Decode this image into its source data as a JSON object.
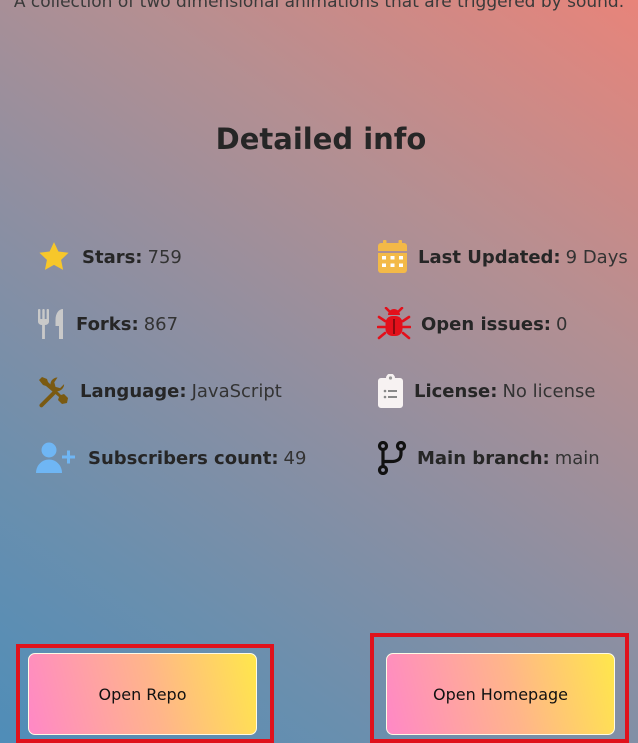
{
  "description": "A collection of two dimensional animations that are triggered by sound.",
  "section_title": "Detailed info",
  "stats": {
    "stars": {
      "label": "Stars:",
      "value": "759",
      "icon": "star-icon"
    },
    "forks": {
      "label": "Forks:",
      "value": "867",
      "icon": "fork-icon"
    },
    "language": {
      "label": "Language:",
      "value": "JavaScript",
      "icon": "tools-icon"
    },
    "subscribers": {
      "label": "Subscribers count:",
      "value": "49",
      "icon": "user-plus-icon"
    },
    "last_updated": {
      "label": "Last Updated:",
      "value": "9 Days",
      "icon": "calendar-icon"
    },
    "open_issues": {
      "label": "Open issues:",
      "value": "0",
      "icon": "bug-icon"
    },
    "license": {
      "label": "License:",
      "value": "No license",
      "icon": "clipboard-icon"
    },
    "main_branch": {
      "label": "Main branch:",
      "value": "main",
      "icon": "branch-icon"
    }
  },
  "buttons": {
    "open_repo": "Open Repo",
    "open_homepage": "Open Homepage"
  },
  "colors": {
    "star": "#f7c72a",
    "fork": "#c9c9c9",
    "tools": "#7a5a12",
    "user": "#6fb6f4",
    "calendar": "#f3b948",
    "bug": "#e3101b",
    "clipboard": "#f7f2f2",
    "branch": "#111111",
    "highlight_frame": "#e0121c"
  }
}
